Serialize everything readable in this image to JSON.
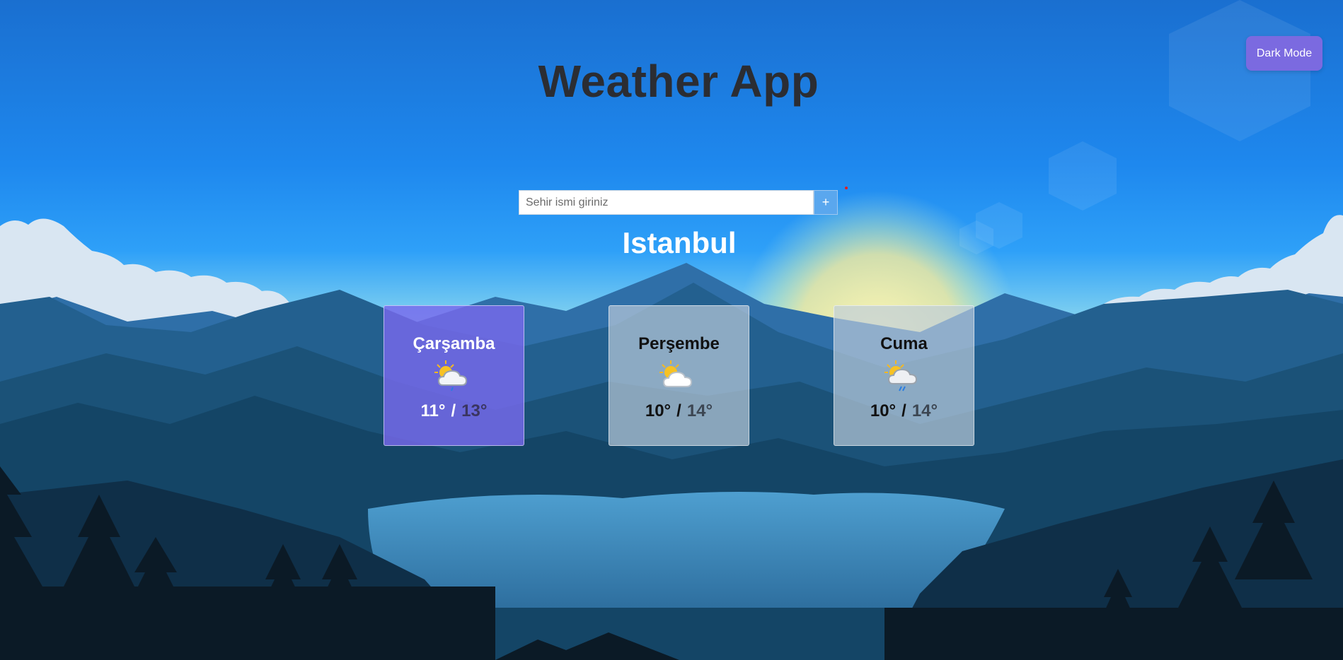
{
  "app": {
    "title": "Weather App"
  },
  "toolbar": {
    "dark_mode_label": "Dark Mode"
  },
  "search": {
    "placeholder": "Sehir ismi giriniz",
    "value": "",
    "add_label": "+"
  },
  "city": {
    "name": "Istanbul"
  },
  "forecast": [
    {
      "day": "Çarşamba",
      "icon": "partly-cloudy-rain-icon",
      "min": "11°",
      "max": "13°",
      "active": true
    },
    {
      "day": "Perşembe",
      "icon": "partly-cloudy-icon",
      "min": "10°",
      "max": "14°",
      "active": false
    },
    {
      "day": "Cuma",
      "icon": "partly-cloudy-rain-icon",
      "min": "10°",
      "max": "14°",
      "active": false
    }
  ],
  "colors": {
    "accent": "#7b6ae0",
    "sky_top": "#1a6fd0",
    "sky_mid": "#2a9af5",
    "sun": "#f5ea9a",
    "mountain_dark": "#0e3656"
  }
}
